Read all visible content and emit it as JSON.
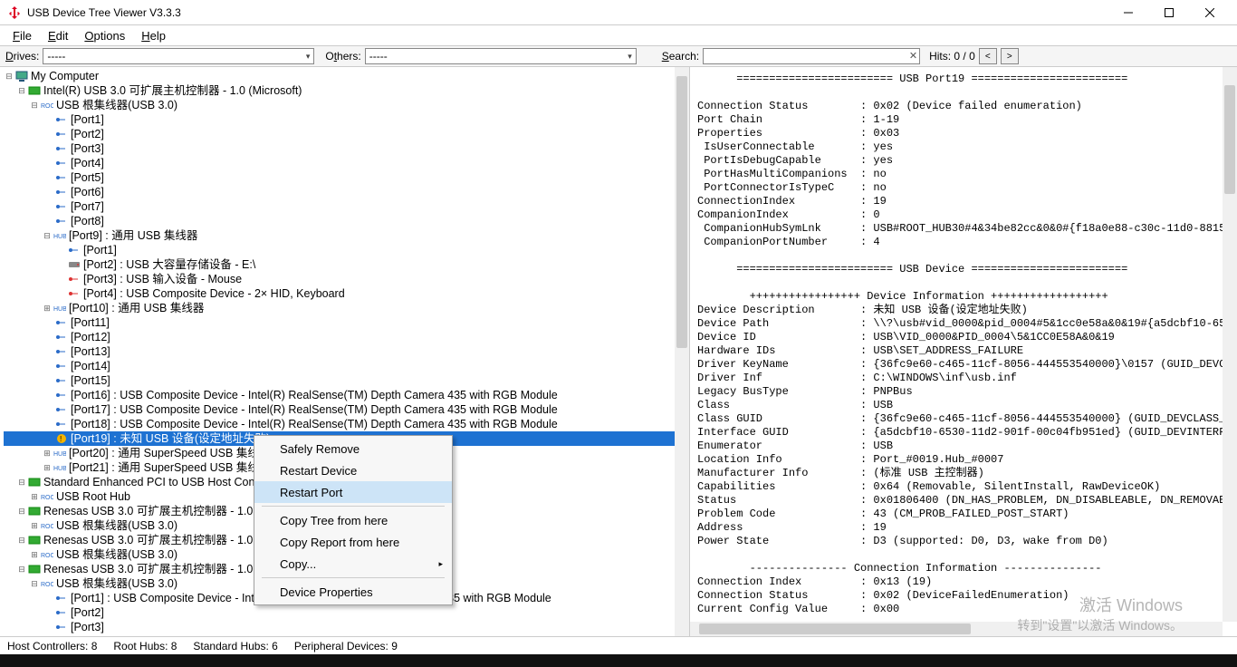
{
  "window": {
    "title": "USB Device Tree Viewer V3.3.3"
  },
  "menu": {
    "file": "File",
    "edit": "Edit",
    "options": "Options",
    "help": "Help"
  },
  "toolbar": {
    "drives_label": "Drives:",
    "drives_value": "-----",
    "others_label": "Others:",
    "others_value": "-----",
    "search_label": "Search:",
    "hits_label": "Hits: 0 / 0"
  },
  "tree": {
    "root": "My Computer",
    "controller1": "Intel(R) USB 3.0 可扩展主机控制器 - 1.0 (Microsoft)",
    "rootHub1": "USB 根集线器(USB 3.0)",
    "port1": "[Port1]",
    "port2": "[Port2]",
    "port3": "[Port3]",
    "port4": "[Port4]",
    "port5": "[Port5]",
    "port6": "[Port6]",
    "port7": "[Port7]",
    "port8": "[Port8]",
    "port9": "[Port9] : 通用 USB 集线器",
    "port9_1": "[Port1]",
    "port9_2": "[Port2] : USB 大容量存储设备 - E:\\",
    "port9_3": "[Port3] : USB 输入设备 - Mouse",
    "port9_4": "[Port4] : USB Composite Device - 2× HID, Keyboard",
    "port10": "[Port10] : 通用 USB 集线器",
    "port11": "[Port11]",
    "port12": "[Port12]",
    "port13": "[Port13]",
    "port14": "[Port14]",
    "port15": "[Port15]",
    "port16": "[Port16] : USB Composite Device - Intel(R) RealSense(TM) Depth Camera 435 with RGB Module",
    "port17": "[Port17] : USB Composite Device - Intel(R) RealSense(TM) Depth Camera 435 with RGB Module",
    "port18": "[Port18] : USB Composite Device - Intel(R) RealSense(TM) Depth Camera 435 with RGB Module",
    "port19": "[Port19] : 未知 USB 设备(设定地址失败)",
    "port20": "[Port20] : 通用 SuperSpeed USB 集线器",
    "port21": "[Port21] : 通用 SuperSpeed USB 集线器",
    "std_ehci": "Standard Enhanced PCI to USB Host Controller",
    "usb_root_hub": "USB Root Hub",
    "renesas1": "Renesas USB 3.0 可扩展主机控制器 - 1.0",
    "renesas1_hub": "USB 根集线器(USB 3.0)",
    "renesas2": "Renesas USB 3.0 可扩展主机控制器 - 1.0",
    "renesas2_hub": "USB 根集线器(USB 3.0)",
    "renesas3": "Renesas USB 3.0 可扩展主机控制器 - 1.0",
    "renesas3_hub": "USB 根集线器(USB 3.0)",
    "renesas3_p1": "[Port1] : USB Composite Device - Intel(R) RealSense(TM) Depth Camera 435 with RGB Module",
    "renesas3_p2": "[Port2]",
    "renesas3_p3": "[Port3]"
  },
  "ctx": {
    "safely_remove": "Safely Remove",
    "restart_device": "Restart Device",
    "restart_port": "Restart Port",
    "copy_tree": "Copy Tree from here",
    "copy_report": "Copy Report from here",
    "copy": "Copy...",
    "device_properties": "Device Properties"
  },
  "details_text": "      ======================== USB Port19 ========================\n\nConnection Status        : 0x02 (Device failed enumeration)\nPort Chain               : 1-19\nProperties               : 0x03\n IsUserConnectable       : yes\n PortIsDebugCapable      : yes\n PortHasMultiCompanions  : no\n PortConnectorIsTypeC    : no\nConnectionIndex          : 19\nCompanionIndex           : 0\n CompanionHubSymLnk      : USB#ROOT_HUB30#4&34be82cc&0&0#{f18a0e88-c30c-11d0-8815-0\n CompanionPortNumber     : 4\n\n      ======================== USB Device ========================\n\n        +++++++++++++++++ Device Information ++++++++++++++++++\nDevice Description       : 未知 USB 设备(设定地址失败)\nDevice Path              : \\\\?\\usb#vid_0000&pid_0004#5&1cc0e58a&0&19#{a5dcbf10-6530\nDevice ID                : USB\\VID_0000&PID_0004\\5&1CC0E58A&0&19\nHardware IDs             : USB\\SET_ADDRESS_FAILURE\nDriver KeyName           : {36fc9e60-c465-11cf-8056-444553540000}\\0157 (GUID_DEVCLA\nDriver Inf               : C:\\WINDOWS\\inf\\usb.inf\nLegacy BusType           : PNPBus\nClass                    : USB\nClass GUID               : {36fc9e60-c465-11cf-8056-444553540000} (GUID_DEVCLASS_US\nInterface GUID           : {a5dcbf10-6530-11d2-901f-00c04fb951ed} (GUID_DEVINTERFAC\nEnumerator               : USB\nLocation Info            : Port_#0019.Hub_#0007\nManufacturer Info        : (标准 USB 主控制器)\nCapabilities             : 0x64 (Removable, SilentInstall, RawDeviceOK)\nStatus                   : 0x01806400 (DN_HAS_PROBLEM, DN_DISABLEABLE, DN_REMOVABLE\nProblem Code             : 43 (CM_PROB_FAILED_POST_START)\nAddress                  : 19\nPower State              : D3 (supported: D0, D3, wake from D0)\n\n        --------------- Connection Information ---------------\nConnection Index         : 0x13 (19)\nConnection Status        : 0x02 (DeviceFailedEnumeration)\nCurrent Config Value     : 0x00",
  "status": {
    "host_controllers": "Host Controllers: 8",
    "root_hubs": "Root Hubs: 8",
    "standard_hubs": "Standard Hubs: 6",
    "peripheral": "Peripheral Devices: 9"
  },
  "watermark": {
    "line1": "激活 Windows",
    "line2": "转到\"设置\"以激活 Windows。"
  }
}
